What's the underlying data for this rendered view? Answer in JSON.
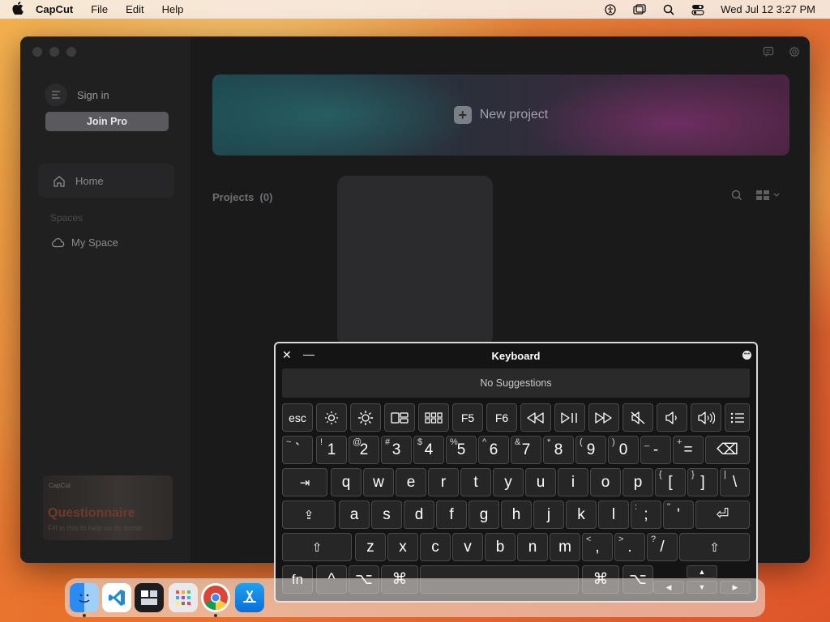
{
  "menubar": {
    "apple_icon": "apple-logo",
    "app_name": "CapCut",
    "menus": [
      "File",
      "Edit",
      "Help"
    ],
    "datetime": "Wed Jul 12  3:27 PM",
    "status_icons": [
      "accessibility-icon",
      "screen-mirroring-icon",
      "spotlight-search-icon",
      "control-center-icon"
    ]
  },
  "capcut": {
    "sidebar": {
      "sign_in": "Sign in",
      "join_pro": "Join Pro",
      "home": "Home",
      "spaces_label": "Spaces",
      "my_space": "My Space",
      "promo": {
        "brand": "CapCut",
        "title": "Questionnaire",
        "subtitle": "Fill in this to help us do better"
      }
    },
    "new_project": "New project",
    "projects_label": "Projects",
    "projects_count": "(0)"
  },
  "keyboard": {
    "title": "Keyboard",
    "suggestions": "No Suggestions",
    "fn_row": [
      "esc",
      "brightness-down-icon",
      "brightness-up-icon",
      "mission-control-icon",
      "launchpad-icon",
      "F5",
      "F6",
      "rewind-icon",
      "play-pause-icon",
      "fast-forward-icon",
      "mute-icon",
      "volume-down-icon",
      "volume-up-icon",
      "list-icon"
    ],
    "fn_labels": {
      "esc": "esc",
      "f5": "F5",
      "f6": "F6"
    },
    "number_row": [
      {
        "s": "~",
        "p": "`"
      },
      {
        "s": "!",
        "p": "1"
      },
      {
        "s": "@",
        "p": "2"
      },
      {
        "s": "#",
        "p": "3"
      },
      {
        "s": "$",
        "p": "4"
      },
      {
        "s": "%",
        "p": "5"
      },
      {
        "s": "^",
        "p": "6"
      },
      {
        "s": "&",
        "p": "7"
      },
      {
        "s": "*",
        "p": "8"
      },
      {
        "s": "(",
        "p": "9"
      },
      {
        "s": ")",
        "p": "0"
      },
      {
        "s": "_",
        "p": "-"
      },
      {
        "s": "+",
        "p": "="
      }
    ],
    "qwerty_row": [
      "q",
      "w",
      "e",
      "r",
      "t",
      "y",
      "u",
      "i",
      "o",
      "p"
    ],
    "qwerty_extra": [
      {
        "s": "{",
        "p": "["
      },
      {
        "s": "}",
        "p": "]"
      },
      {
        "s": "|",
        "p": "\\"
      }
    ],
    "home_row": [
      "a",
      "s",
      "d",
      "f",
      "g",
      "h",
      "j",
      "k",
      "l"
    ],
    "home_extra": [
      {
        "s": ":",
        "p": ";"
      },
      {
        "s": "\"",
        "p": "'"
      }
    ],
    "bottom_row": [
      "z",
      "x",
      "c",
      "v",
      "b",
      "n",
      "m"
    ],
    "bottom_extra": [
      {
        "s": "<",
        "p": ","
      },
      {
        "s": ">",
        "p": "."
      },
      {
        "s": "?",
        "p": "/"
      }
    ],
    "fn_key": "fn",
    "control_symbol": "^",
    "option_symbol": "⌥",
    "command_symbol": "⌘",
    "tab_symbol": "⇥",
    "caps_symbol": "⇪",
    "shift_symbol": "⇧",
    "return_symbol": "⏎",
    "delete_symbol": "⌫",
    "arrows": {
      "up": "▲",
      "down": "▼",
      "left": "◀",
      "right": "▶"
    }
  },
  "dock": {
    "apps": [
      "finder-icon",
      "vscode-icon",
      "mission-control-app-icon",
      "launchpad-app-icon",
      "chrome-icon",
      "app-store-icon"
    ]
  }
}
